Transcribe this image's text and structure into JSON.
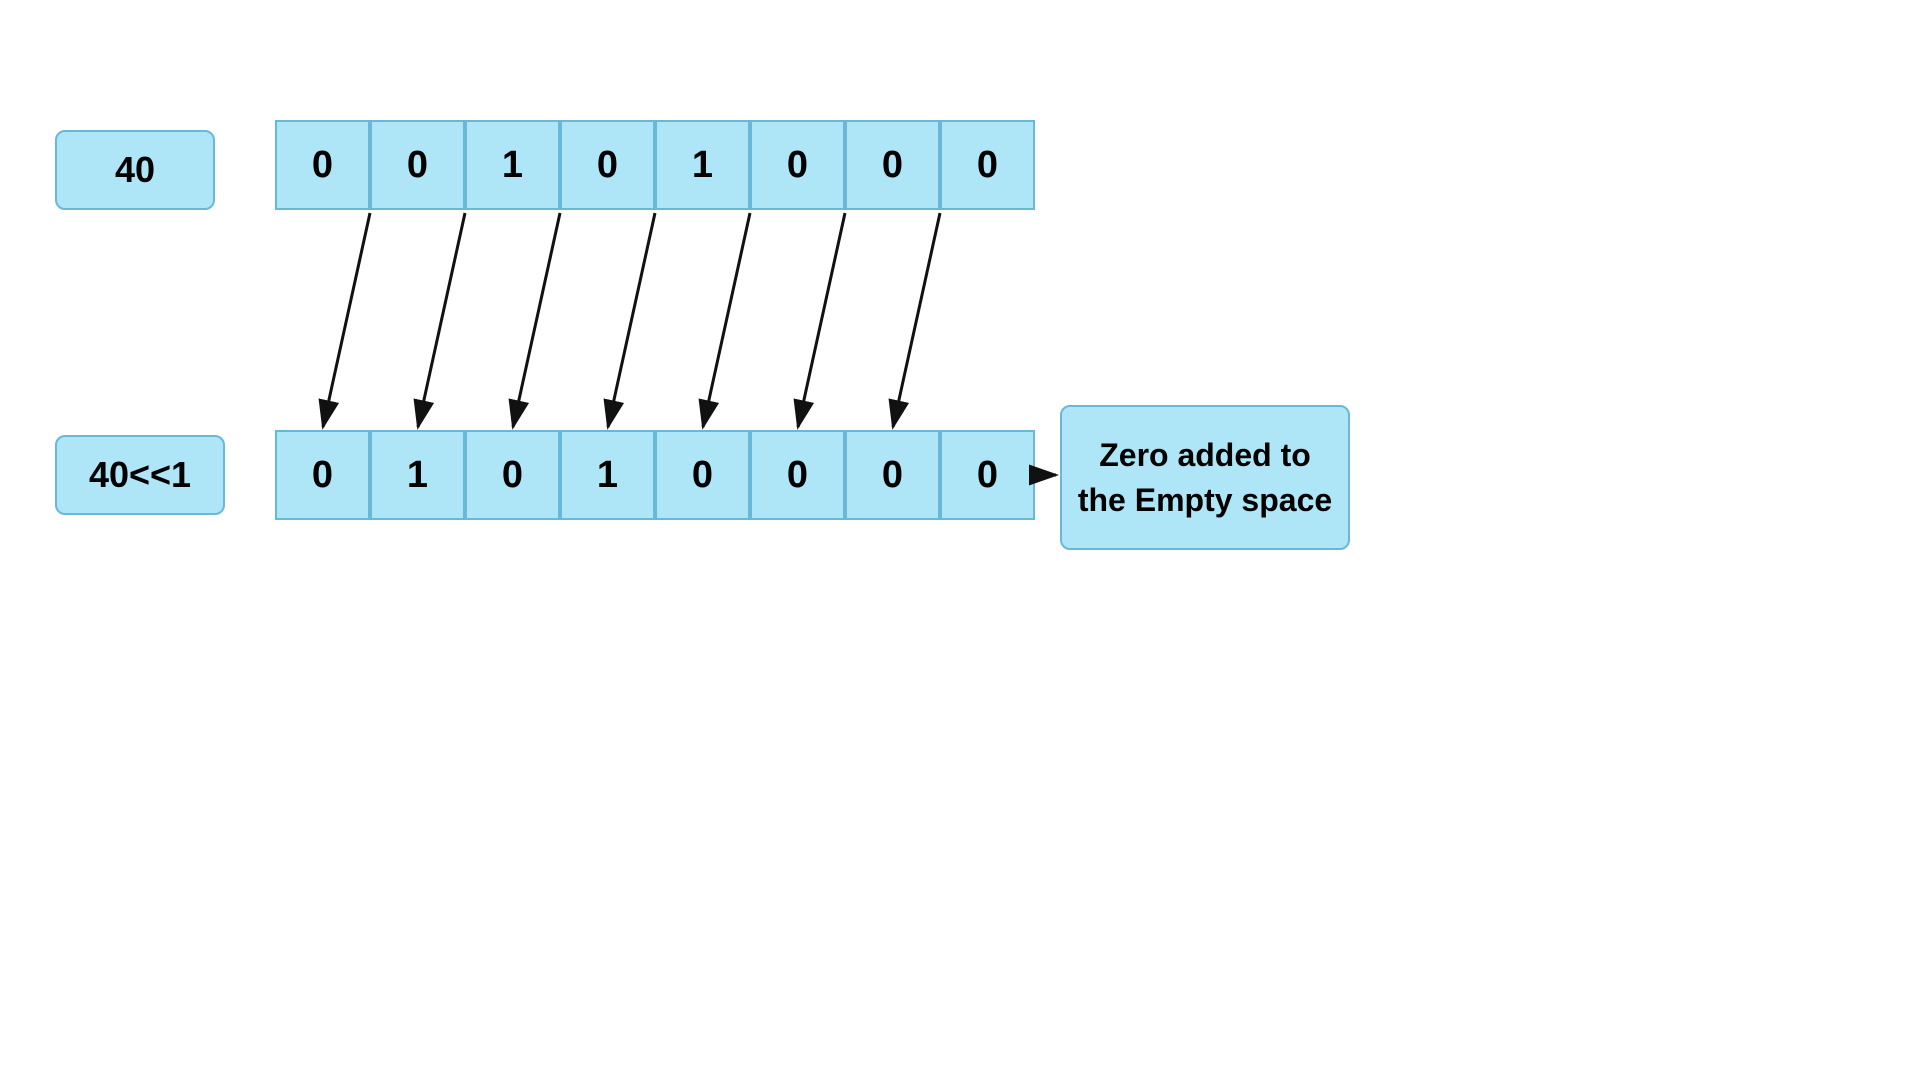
{
  "label_40": "40",
  "label_40shl1": "40<<1",
  "top_bits": [
    "0",
    "0",
    "1",
    "0",
    "1",
    "0",
    "0",
    "0"
  ],
  "bot_bits": [
    "0",
    "1",
    "0",
    "1",
    "0",
    "0",
    "0",
    "0"
  ],
  "info_box_text": "Zero added to the Empty space",
  "colors": {
    "cell_bg": "#aee6f8",
    "cell_border": "#6ab8d8"
  }
}
